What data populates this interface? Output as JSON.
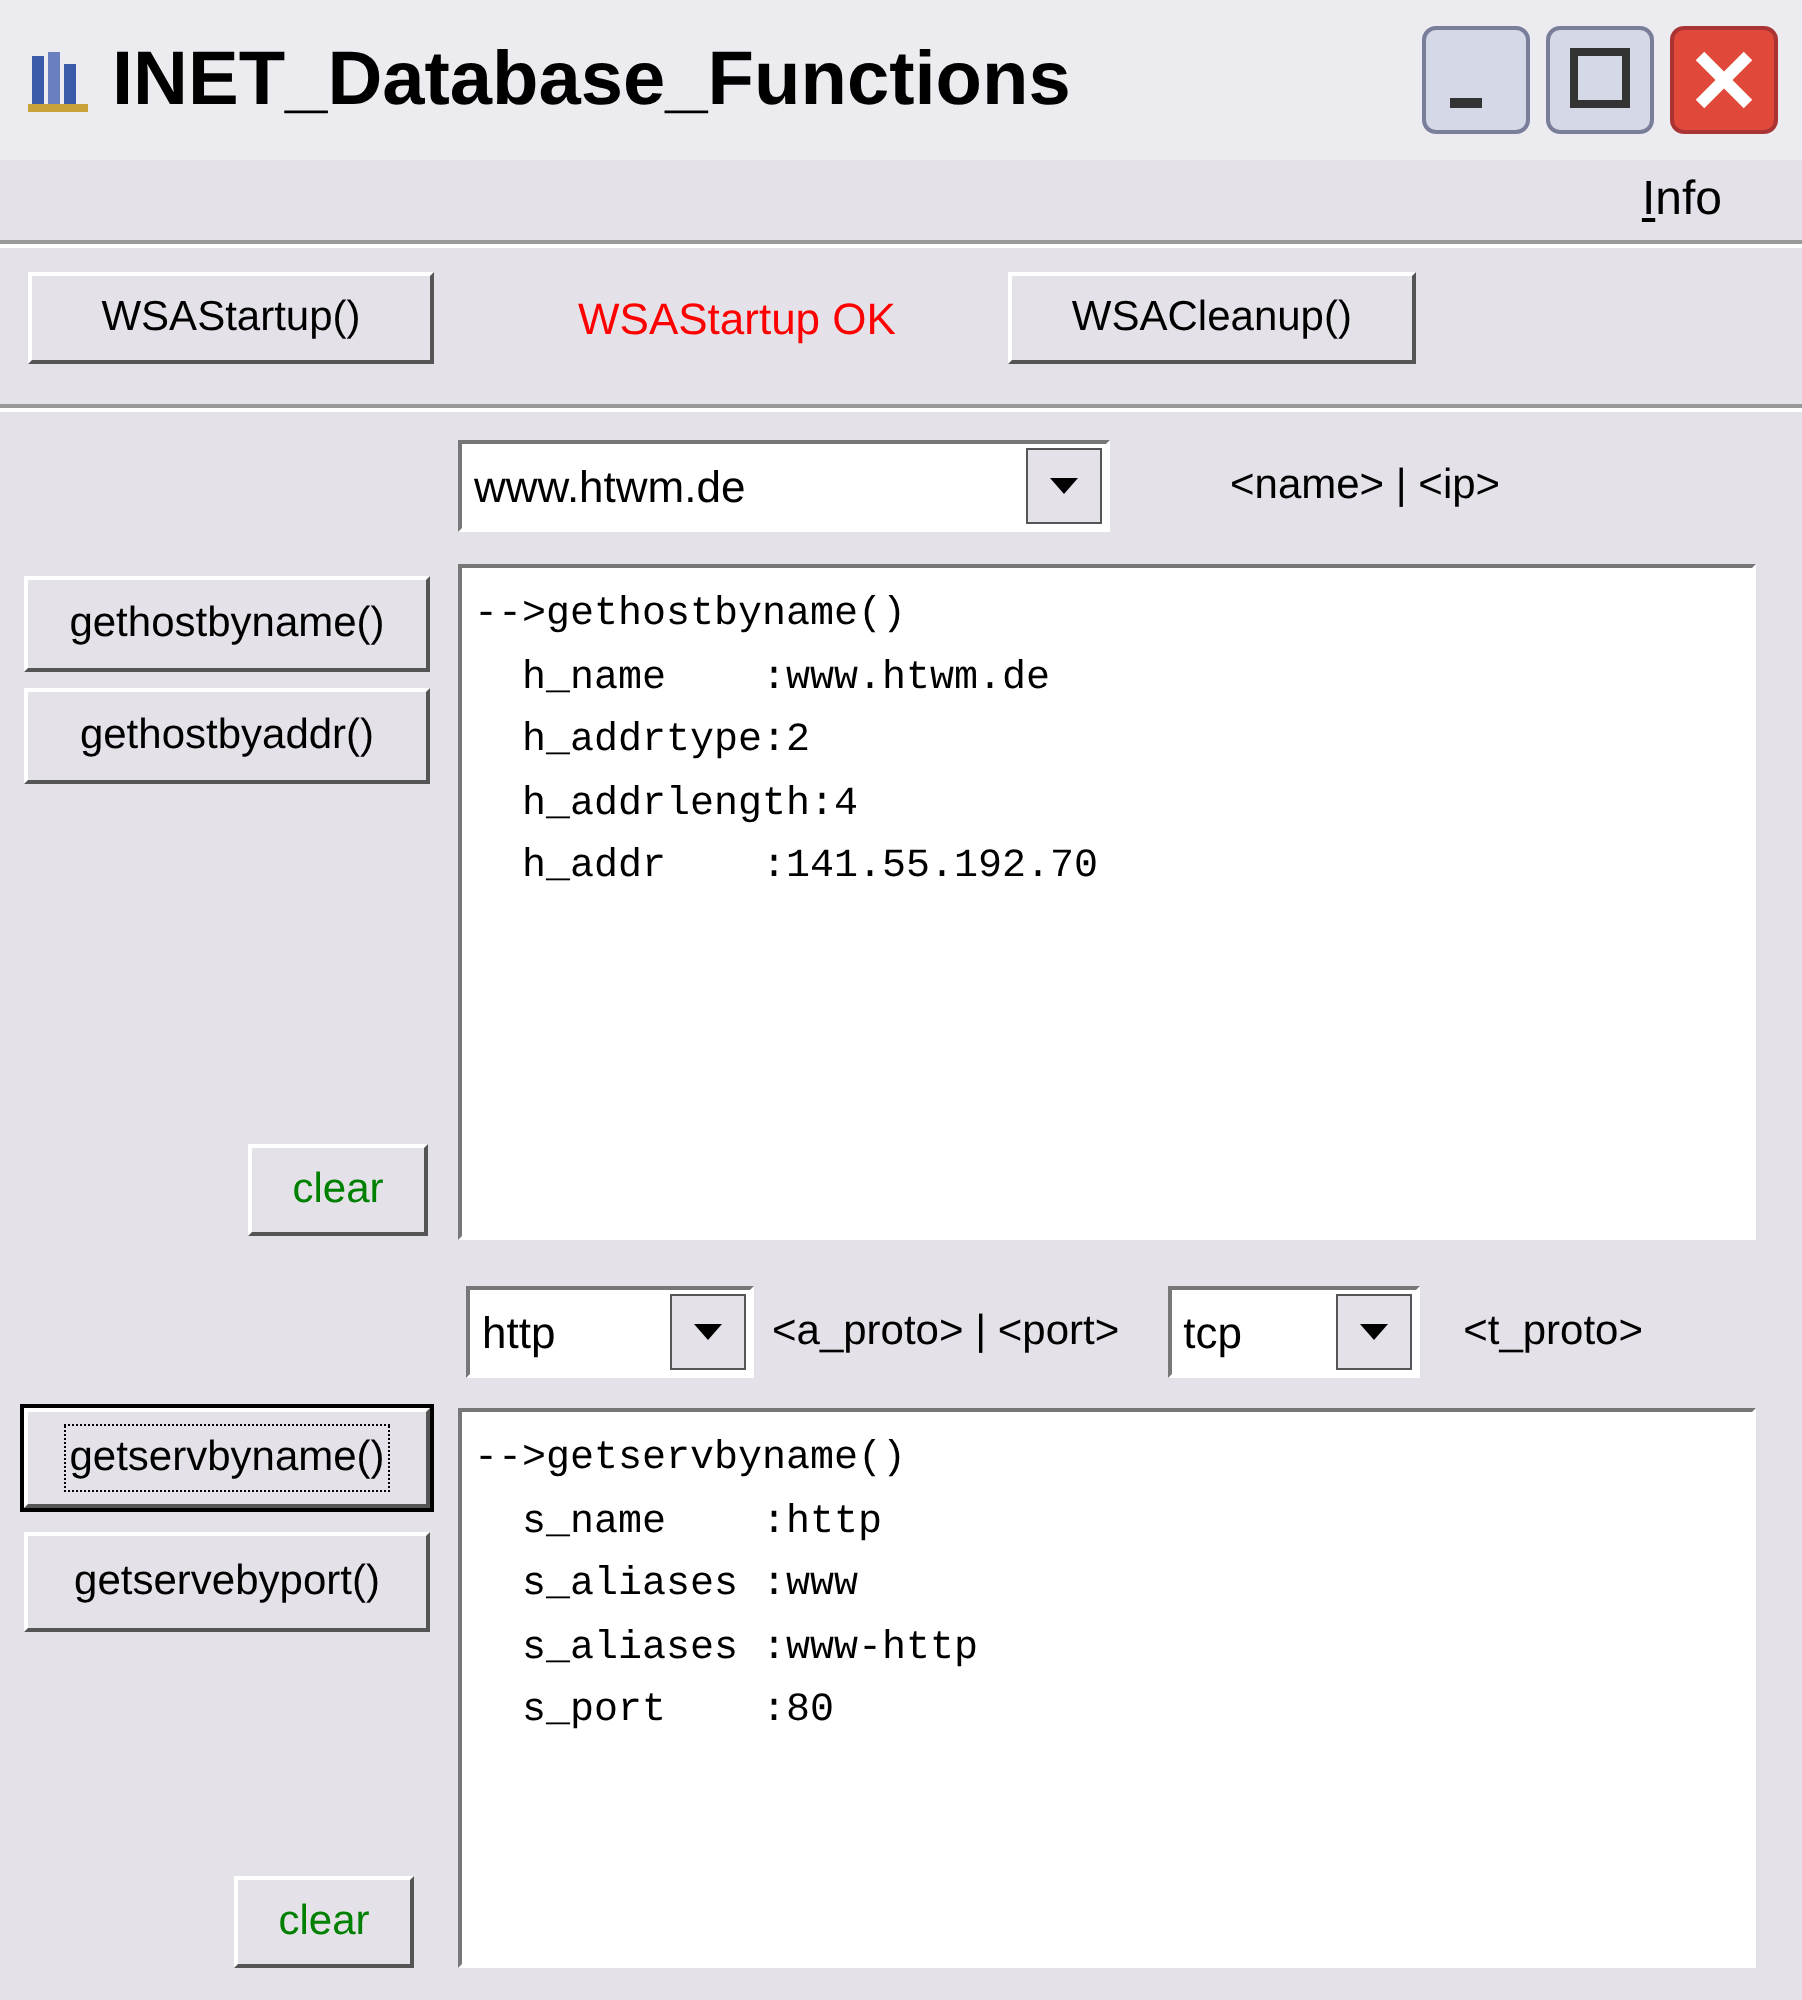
{
  "window": {
    "title": "INET_Database_Functions"
  },
  "menu": [
    {
      "label": "Info"
    }
  ],
  "startup": {
    "start_button": "WSAStartup()",
    "status": "WSAStartup OK",
    "cleanup_button": "WSACleanup()"
  },
  "host": {
    "combo": "www.htwm.de",
    "hint": "<name> | <ip>",
    "buttons": [
      {
        "label": "gethostbyname()",
        "focused": false
      },
      {
        "label": "gethostbyaddr()",
        "focused": false
      }
    ],
    "clear": "clear",
    "output": [
      "-->gethostbyname()",
      "  h_name    :www.htwm.de",
      "  h_addrtype:2",
      "  h_addrlength:4",
      "  h_addr    :141.55.192.70"
    ]
  },
  "service": {
    "service_combo": "http",
    "service_hint": "<a_proto> | <port>",
    "proto_combo": "tcp",
    "proto_hint": "<t_proto>",
    "buttons": [
      {
        "label": "getservbyname()",
        "focused": true
      },
      {
        "label": "getservebyport()",
        "focused": false
      }
    ],
    "clear": "clear",
    "output": [
      "-->getservbyname()",
      "  s_name    :http",
      "  s_aliases :www",
      "  s_aliases :www-http",
      "  s_port    :80"
    ]
  }
}
